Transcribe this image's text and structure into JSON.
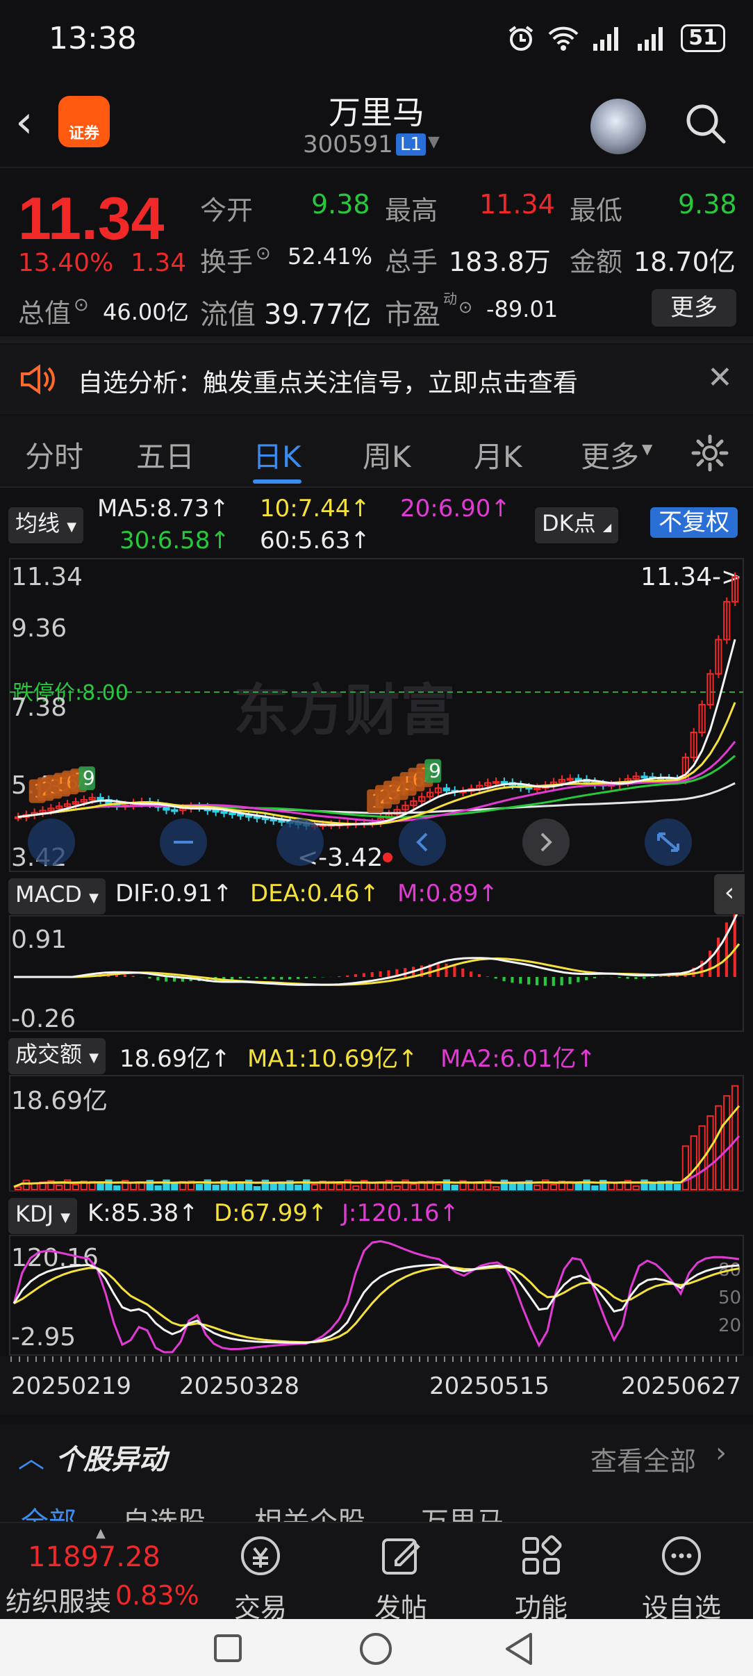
{
  "status": {
    "time": "13:38",
    "battery": "51"
  },
  "header": {
    "title": "万里马",
    "code": "300591",
    "level": "L1",
    "logo_text": "证券"
  },
  "quote": {
    "price": "11.34",
    "change_pct": "13.40%",
    "change": "1.34",
    "open_label": "今开",
    "open": "9.38",
    "high_label": "最高",
    "high": "11.34",
    "low_label": "最低",
    "low": "9.38",
    "turnover_label": "换手",
    "turnover": "52.41%",
    "volume_label": "总手",
    "volume": "183.8万",
    "amount_label": "金额",
    "amount": "18.70亿",
    "mktcap_label": "总值",
    "mktcap": "46.00亿",
    "float_label": "流值",
    "float": "39.77亿",
    "pe_label": "市盈",
    "pe_sup": "动",
    "pe": "-89.01",
    "more": "更多"
  },
  "banner": {
    "text": "自选分析：触发重点关注信号，立即点击查看"
  },
  "tabs": [
    "分时",
    "五日",
    "日K",
    "周K",
    "月K",
    "更多"
  ],
  "ma_row": {
    "label": "均线",
    "ma5": "MA5:8.73↑",
    "ma10": "10:7.44↑",
    "ma20": "20:6.90↑",
    "ma30": "30:6.58↑",
    "ma60": "60:5.63↑",
    "dk": "DK点",
    "fq": "不复权"
  },
  "main_chart": {
    "y_max": "11.34",
    "y_2": "9.36",
    "y_3": "7.38",
    "y_4": "5.40",
    "y_min": "3.42",
    "last_marker": "11.34->",
    "low_marker": "<-3.42",
    "limit_label": "跌停价:8.00",
    "watermark": "东方财富",
    "seq1": [
      "1",
      "2",
      "3",
      "5",
      "6",
      "7",
      "9"
    ],
    "seq2": [
      "1",
      "2",
      "3",
      "4",
      "5",
      "6",
      "7",
      "9"
    ]
  },
  "macd_row": {
    "label": "MACD",
    "dif": "DIF:0.91↑",
    "dea": "DEA:0.46↑",
    "m": "M:0.89↑",
    "y_max": "0.91",
    "y_min": "-0.26"
  },
  "vol_row": {
    "label": "成交额",
    "val": "18.69亿↑",
    "ma1": "MA1:10.69亿↑",
    "ma2": "MA2:6.01亿↑",
    "y_max": "18.69亿"
  },
  "kdj_row": {
    "label": "KDJ",
    "k": "K:85.38↑",
    "d": "D:67.99↑",
    "j": "J:120.16↑",
    "y_max": "120.16",
    "y_min": "-2.95",
    "r80": "80",
    "r50": "50",
    "r20": "20"
  },
  "dates": [
    "20250219",
    "20250328",
    "20250515",
    "20250627"
  ],
  "news": {
    "title": "个股异动",
    "more": "查看全部",
    "subtabs": [
      "全部",
      "自选股",
      "相关个股",
      "万里马"
    ]
  },
  "bottom": {
    "index_value": "11897.28",
    "index_name": "纺织服装",
    "index_change": "0.83%",
    "items": [
      "交易",
      "发帖",
      "功能",
      "设自选"
    ]
  },
  "colors": {
    "up": "#f02828",
    "down": "#27c83c",
    "accent": "#3a8cf0",
    "ma5": "#ececec",
    "ma10": "#f4e23a",
    "ma20": "#e23ad4"
  }
}
